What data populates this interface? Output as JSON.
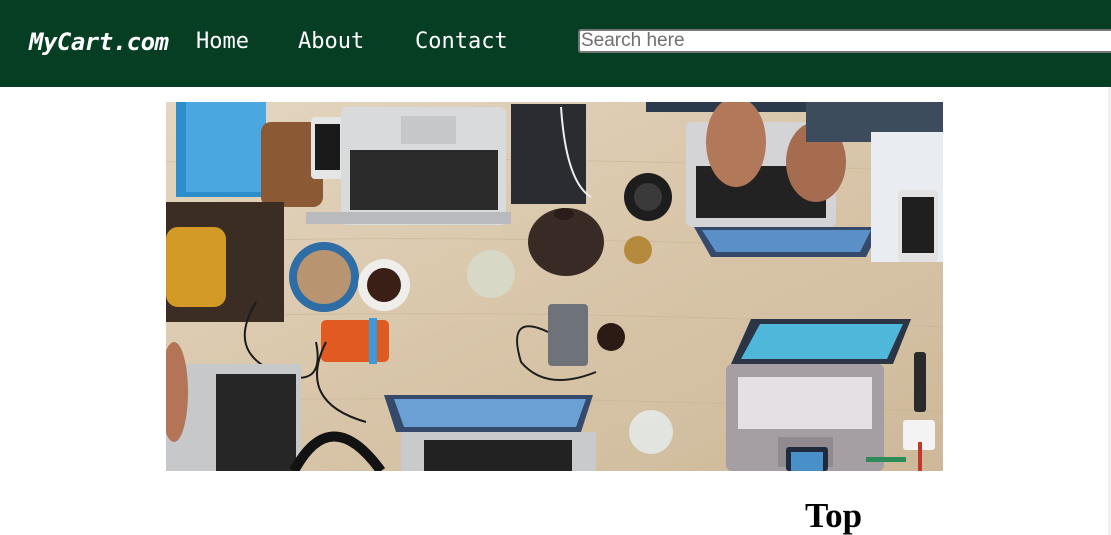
{
  "navbar": {
    "brand": "MyCart.com",
    "links": [
      {
        "label": "Home"
      },
      {
        "label": "About"
      },
      {
        "label": "Contact"
      }
    ],
    "search": {
      "placeholder": "Search here",
      "value": ""
    },
    "background_color": "#063e24"
  },
  "hero": {
    "subject": "top-down photo of a wooden desk with laptops, phones and accessories"
  },
  "main": {
    "section_title": "Top"
  }
}
